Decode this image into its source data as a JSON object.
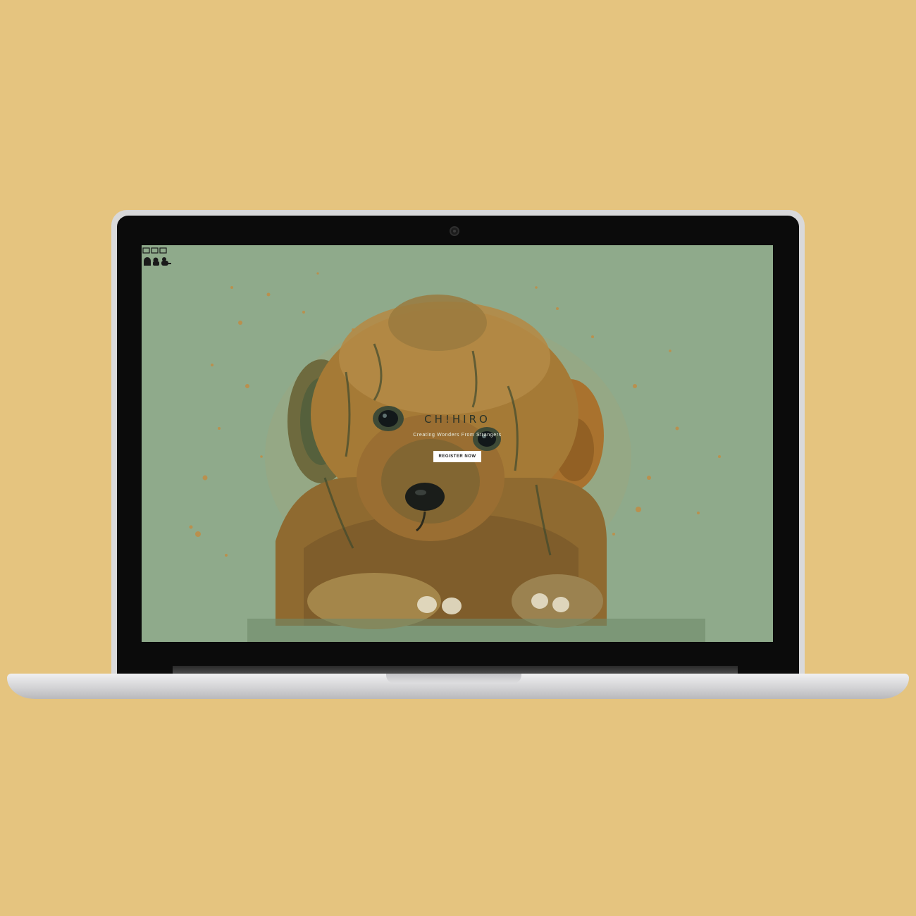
{
  "colors": {
    "page_background": "#E5C47F",
    "screen_overlay": "#8FAA8B",
    "laptop_shell": "#D9D9DA",
    "bezel": "#0B0B0B"
  },
  "website": {
    "brand": "CH!HIRO",
    "tagline": "Creating Wonders From Strangers",
    "cta_label": "REGISTER NOW"
  },
  "icons": {
    "logo": "cartoon-characters-logo-icon",
    "camera": "webcam-icon"
  }
}
